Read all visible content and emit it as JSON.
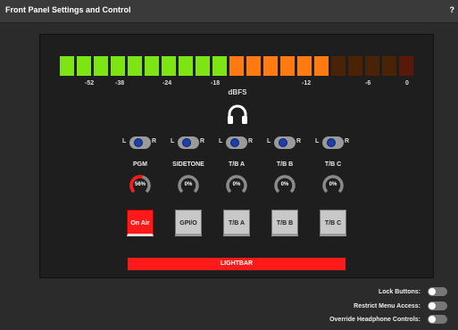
{
  "titlebar": {
    "title": "Front Panel Settings and Control",
    "help": "?"
  },
  "meter": {
    "segments_lit": [
      "#7ee514",
      "#7ee514",
      "#7ee514",
      "#7ee514",
      "#7ee514",
      "#7ee514",
      "#7ee514",
      "#7ee514",
      "#7ee514",
      "#7ee514"
    ],
    "segments_orange": [
      "#ff7a10",
      "#ff7a10",
      "#ff7a10",
      "#ff7a10",
      "#ff7a10",
      "#ff7a10"
    ],
    "segments_dim": [
      "#4a2205",
      "#4a2205",
      "#4a2205",
      "#4a2205",
      "#5a1808"
    ],
    "ticks": [
      "-52",
      "-38",
      "-24",
      "-18",
      "-12",
      "-6",
      "0"
    ],
    "unit": "dBFS"
  },
  "pan": {
    "left": "L",
    "right": "R"
  },
  "channels": [
    {
      "name": "PGM",
      "level": "56%",
      "level_value": 0.56,
      "button": "On Air",
      "active": true
    },
    {
      "name": "SIDETONE",
      "level": "0%",
      "level_value": 0,
      "button": "GPI/O",
      "active": false
    },
    {
      "name": "T/B A",
      "level": "0%",
      "level_value": 0,
      "button": "T/B A",
      "active": false
    },
    {
      "name": "T/B B",
      "level": "0%",
      "level_value": 0,
      "button": "T/B B",
      "active": false
    },
    {
      "name": "T/B C",
      "level": "0%",
      "level_value": 0,
      "button": "T/B C",
      "active": false
    }
  ],
  "lightbar": {
    "label": "LIGHTBAR"
  },
  "settings": [
    {
      "label": "Lock Buttons:"
    },
    {
      "label": "Restrict Menu Access:"
    },
    {
      "label": "Override Headphone Controls:"
    }
  ],
  "colors": {
    "accent_red": "#ff1a1a",
    "meter_green": "#7ee514",
    "meter_orange": "#ff7a10",
    "pan_knob": "#1c3fa8"
  },
  "icons": {
    "headphones": "headphones-icon"
  }
}
